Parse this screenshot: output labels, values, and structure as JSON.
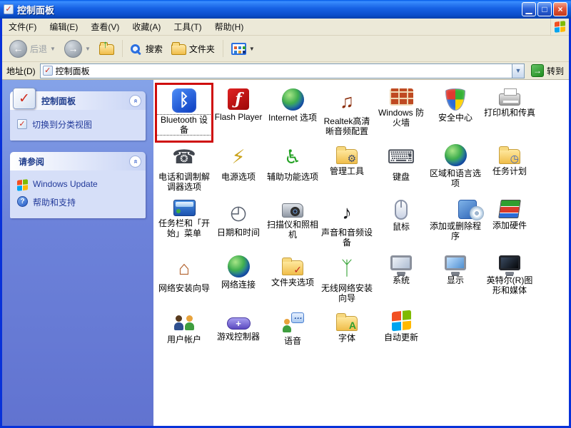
{
  "window": {
    "title": "控制面板"
  },
  "titlebar": {
    "buttons": [
      {
        "name": "minimize",
        "glyph": "▁"
      },
      {
        "name": "maximize",
        "glyph": "□"
      },
      {
        "name": "close",
        "glyph": "×"
      }
    ]
  },
  "menubar": {
    "items": [
      {
        "name": "file",
        "label": "文件(F)"
      },
      {
        "name": "edit",
        "label": "编辑(E)"
      },
      {
        "name": "view",
        "label": "查看(V)"
      },
      {
        "name": "favorites",
        "label": "收藏(A)"
      },
      {
        "name": "tools",
        "label": "工具(T)"
      },
      {
        "name": "help",
        "label": "帮助(H)"
      }
    ]
  },
  "toolbar": {
    "back_label": "后退",
    "search_label": "搜索",
    "folders_label": "文件夹"
  },
  "addressbar": {
    "label": "地址(D)",
    "value": "控制面板",
    "go_label": "转到"
  },
  "sidebar": {
    "panels": [
      {
        "name": "control-panel",
        "title": "控制面板",
        "header_icon": "control-panel-icon",
        "items": [
          {
            "name": "switch-to-category-view",
            "label": "切换到分类视图",
            "icon": "category-view-icon"
          }
        ]
      },
      {
        "name": "see-also",
        "title": "请参阅",
        "items": [
          {
            "name": "windows-update",
            "label": "Windows Update",
            "icon": "windows-flag-icon"
          },
          {
            "name": "help-and-support",
            "label": "帮助和支持",
            "icon": "help-icon"
          }
        ]
      }
    ]
  },
  "content": {
    "items": [
      {
        "name": "bluetooth-devices",
        "label": "Bluetooth 设备",
        "icon": "bt",
        "glyph": "ᛒ",
        "selected": true
      },
      {
        "name": "flash-player",
        "label": "Flash Player",
        "icon": "flash",
        "glyph": "ƒ"
      },
      {
        "name": "internet-options",
        "label": "Internet 选项",
        "icon": "globe",
        "glyph": ""
      },
      {
        "name": "realtek-hd-audio-config",
        "label": "Realtek高清晰音频配置",
        "icon": "plain",
        "glyph": "♫",
        "color": "#8b2f0e"
      },
      {
        "name": "windows-firewall",
        "label": "Windows 防火墙",
        "icon": "wall",
        "glyph": ""
      },
      {
        "name": "security-center",
        "label": "安全中心",
        "icon": "shield",
        "glyph": ""
      },
      {
        "name": "printers-and-faxes",
        "label": "打印机和传真",
        "icon": "printer",
        "glyph": ""
      },
      {
        "name": "phone-and-modem-options",
        "label": "电话和调制解调器选项",
        "icon": "plain",
        "glyph": "☎",
        "color": "#41464e"
      },
      {
        "name": "power-options",
        "label": "电源选项",
        "icon": "plain",
        "glyph": "⚡",
        "color": "#caa21a"
      },
      {
        "name": "accessibility-options",
        "label": "辅助功能选项",
        "icon": "plain",
        "glyph": "♿",
        "color": "#23a123"
      },
      {
        "name": "administrative-tools",
        "label": "管理工具",
        "icon": "folder",
        "glyph": "⚙",
        "color": "#44506a"
      },
      {
        "name": "keyboard",
        "label": "键盘",
        "icon": "plain",
        "glyph": "⌨",
        "color": "#4a505a"
      },
      {
        "name": "regional-and-language-options",
        "label": "区域和语言选项",
        "icon": "globe",
        "glyph": ""
      },
      {
        "name": "scheduled-tasks",
        "label": "任务计划",
        "icon": "folder",
        "glyph": "◷",
        "color": "#3a62c0"
      },
      {
        "name": "taskbar-and-start-menu",
        "label": "任务栏和「开始」菜单",
        "icon": "taskbar",
        "glyph": ""
      },
      {
        "name": "date-and-time",
        "label": "日期和时间",
        "icon": "plain",
        "glyph": "◴",
        "color": "#5a6270"
      },
      {
        "name": "scanners-and-cameras",
        "label": "扫描仪和照相机",
        "icon": "camera",
        "glyph": ""
      },
      {
        "name": "sounds-and-audio-devices",
        "label": "声音和音频设备",
        "icon": "plain",
        "glyph": "♪",
        "color": "#17181c"
      },
      {
        "name": "mouse",
        "label": "鼠标",
        "icon": "mouse",
        "glyph": ""
      },
      {
        "name": "add-or-remove-programs",
        "label": "添加或删除程序",
        "icon": "cd",
        "glyph": ""
      },
      {
        "name": "add-hardware",
        "label": "添加硬件",
        "icon": "stack",
        "glyph": ""
      },
      {
        "name": "network-setup-wizard",
        "label": "网络安装向导",
        "icon": "plain",
        "glyph": "⌂",
        "color": "#b2622d"
      },
      {
        "name": "network-connections",
        "label": "网络连接",
        "icon": "globe",
        "glyph": ""
      },
      {
        "name": "folder-options",
        "label": "文件夹选项",
        "icon": "folder",
        "glyph": "✓",
        "color": "#c0251c"
      },
      {
        "name": "wireless-network-setup-wizard",
        "label": "无线网络安装向导",
        "icon": "plain",
        "glyph": "ᛉ",
        "color": "#36a336"
      },
      {
        "name": "system",
        "label": "系统",
        "icon": "monitor-gray",
        "glyph": ""
      },
      {
        "name": "display",
        "label": "显示",
        "icon": "monitor",
        "glyph": ""
      },
      {
        "name": "intel-graphics-and-media",
        "label": "英特尔(R)图形和媒体",
        "icon": "monitor-black",
        "glyph": ""
      },
      {
        "name": "user-accounts",
        "label": "用户帐户",
        "icon": "users",
        "glyph": ""
      },
      {
        "name": "game-controllers",
        "label": "游戏控制器",
        "icon": "gamepad",
        "glyph": "+"
      },
      {
        "name": "speech",
        "label": "语音",
        "icon": "speech",
        "glyph": ""
      },
      {
        "name": "fonts",
        "label": "字体",
        "icon": "folder",
        "glyph": "A",
        "color": "#2f9e2f"
      },
      {
        "name": "automatic-updates",
        "label": "自动更新",
        "icon": "winflag",
        "glyph": ""
      }
    ]
  },
  "annotation": {
    "type": "highlight-box",
    "color": "#cf0d0d",
    "target": "bluetooth-devices"
  }
}
